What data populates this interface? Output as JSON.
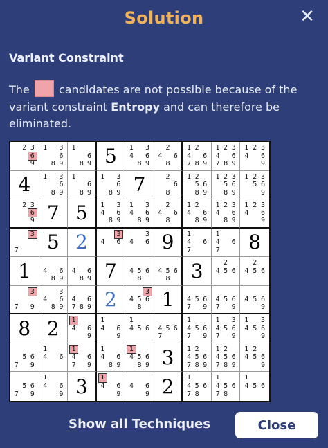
{
  "dialog": {
    "title": "Solution",
    "close_icon": "close-icon",
    "subtitle": "Variant Constraint",
    "desc_part1": "The",
    "desc_part2": " candidates are not possible because of the variant constraint ",
    "desc_bold": "Entropy",
    "desc_part3": " and can therefore be eliminated.",
    "swatch_color": "#f0a3a8",
    "show_all_label": "Show all Techniques",
    "close_label": "Close"
  },
  "colors": {
    "background": "#2e3e78",
    "title": "#f0b25a",
    "highlight": "#f0a3a8",
    "user_digit": "#3a6fc4"
  },
  "grid": {
    "cells": [
      [
        {
          "c": [
            2,
            3,
            6,
            9
          ],
          "h": [
            6
          ]
        },
        {
          "c": [
            1,
            3,
            6,
            8,
            9
          ]
        },
        {
          "c": [
            1,
            6,
            8,
            9
          ]
        },
        {
          "v": 5
        },
        {
          "c": [
            1,
            3,
            4,
            6,
            8,
            9
          ]
        },
        {
          "c": [
            2,
            4,
            6,
            8
          ]
        },
        {
          "c": [
            1,
            2,
            4,
            6,
            7,
            8,
            9
          ]
        },
        {
          "c": [
            1,
            2,
            3,
            4,
            6,
            7,
            8,
            9
          ]
        },
        {
          "c": [
            1,
            2,
            3,
            4,
            6,
            9
          ]
        }
      ],
      [
        {
          "v": 4
        },
        {
          "c": [
            1,
            3,
            6,
            8,
            9
          ]
        },
        {
          "c": [
            1,
            6,
            8,
            9
          ]
        },
        {
          "c": [
            1,
            3,
            6,
            8,
            9
          ]
        },
        {
          "v": 7
        },
        {
          "c": [
            2,
            6,
            8
          ]
        },
        {
          "c": [
            1,
            2,
            5,
            6,
            8,
            9
          ]
        },
        {
          "c": [
            1,
            2,
            3,
            5,
            6,
            8,
            9
          ]
        },
        {
          "c": [
            1,
            2,
            3,
            5,
            6,
            9
          ]
        }
      ],
      [
        {
          "c": [
            2,
            3,
            6,
            9
          ],
          "h": [
            6
          ]
        },
        {
          "v": 7
        },
        {
          "v": 5
        },
        {
          "c": [
            1,
            3,
            4,
            6,
            8,
            9
          ]
        },
        {
          "c": [
            1,
            3,
            4,
            6,
            8,
            9
          ]
        },
        {
          "c": [
            2,
            4,
            6,
            8
          ]
        },
        {
          "c": [
            1,
            2,
            4,
            6,
            8,
            9
          ]
        },
        {
          "c": [
            1,
            2,
            3,
            4,
            6,
            8,
            9
          ]
        },
        {
          "c": [
            1,
            2,
            3,
            4,
            6,
            9
          ]
        }
      ],
      [
        {
          "c": [
            3,
            7
          ],
          "h": [
            3
          ]
        },
        {
          "v": 5
        },
        {
          "v": 2,
          "u": true
        },
        {
          "c": [
            3,
            4,
            6
          ],
          "h": [
            3
          ]
        },
        {
          "c": [
            3,
            4,
            6
          ]
        },
        {
          "v": 9
        },
        {
          "c": [
            1,
            4,
            6,
            7
          ]
        },
        {
          "c": [
            1,
            4,
            6,
            7
          ]
        },
        {
          "v": 8
        }
      ],
      [
        {
          "v": 1
        },
        {
          "c": [
            4,
            6,
            8,
            9
          ]
        },
        {
          "c": [
            4,
            6,
            8,
            9
          ]
        },
        {
          "v": 7
        },
        {
          "c": [
            4,
            5,
            6,
            8
          ]
        },
        {
          "c": [
            4,
            5,
            6,
            8
          ]
        },
        {
          "v": 3
        },
        {
          "c": [
            2,
            4,
            5,
            6
          ]
        },
        {
          "c": [
            2,
            4,
            5,
            6
          ]
        }
      ],
      [
        {
          "c": [
            3,
            7,
            9
          ],
          "h": [
            3
          ]
        },
        {
          "c": [
            3,
            4,
            6,
            8,
            9
          ]
        },
        {
          "c": [
            4,
            6,
            7,
            8,
            9
          ]
        },
        {
          "v": 2,
          "u": true
        },
        {
          "c": [
            3,
            4,
            5,
            6,
            8
          ],
          "h": [
            3
          ]
        },
        {
          "v": 1
        },
        {
          "c": [
            4,
            5,
            6,
            7,
            9
          ]
        },
        {
          "c": [
            4,
            5,
            6,
            7,
            9
          ]
        },
        {
          "c": [
            4,
            5,
            6,
            9
          ]
        }
      ],
      [
        {
          "v": 8
        },
        {
          "v": 2
        },
        {
          "c": [
            1,
            4,
            6,
            9
          ],
          "h": [
            1
          ]
        },
        {
          "c": [
            1,
            4,
            6,
            9
          ]
        },
        {
          "c": [
            1,
            4,
            5,
            6
          ]
        },
        {
          "c": [
            4,
            5,
            6,
            7
          ]
        },
        {
          "c": [
            1,
            4,
            5,
            6,
            7,
            9
          ]
        },
        {
          "c": [
            1,
            3,
            4,
            5,
            6,
            7,
            9
          ]
        },
        {
          "c": [
            1,
            3,
            4,
            5,
            6,
            9
          ]
        }
      ],
      [
        {
          "c": [
            5,
            6,
            7,
            9
          ]
        },
        {
          "c": [
            1,
            4,
            6
          ]
        },
        {
          "c": [
            1,
            4,
            6,
            7,
            9
          ],
          "h": [
            1
          ]
        },
        {
          "c": [
            1,
            4,
            6,
            8,
            9
          ]
        },
        {
          "c": [
            1,
            4,
            5,
            6,
            8,
            9
          ],
          "h": [
            1
          ]
        },
        {
          "v": 3
        },
        {
          "c": [
            1,
            2,
            4,
            5,
            6,
            7,
            8,
            9
          ]
        },
        {
          "c": [
            1,
            2,
            4,
            5,
            6,
            7,
            8,
            9
          ]
        },
        {
          "c": [
            1,
            2,
            4,
            5,
            6,
            9
          ]
        }
      ],
      [
        {
          "c": [
            5,
            6,
            7,
            9
          ]
        },
        {
          "c": [
            1,
            4,
            6,
            9
          ]
        },
        {
          "v": 3
        },
        {
          "c": [
            1,
            4,
            6,
            9
          ],
          "h": [
            1
          ]
        },
        {
          "c": [
            4,
            6,
            9
          ]
        },
        {
          "v": 2
        },
        {
          "c": [
            1,
            4,
            5,
            6,
            7,
            8
          ]
        },
        {
          "c": [
            1,
            4,
            5,
            6,
            7,
            8
          ]
        },
        {
          "c": [
            1,
            4,
            5,
            6
          ]
        }
      ]
    ]
  }
}
